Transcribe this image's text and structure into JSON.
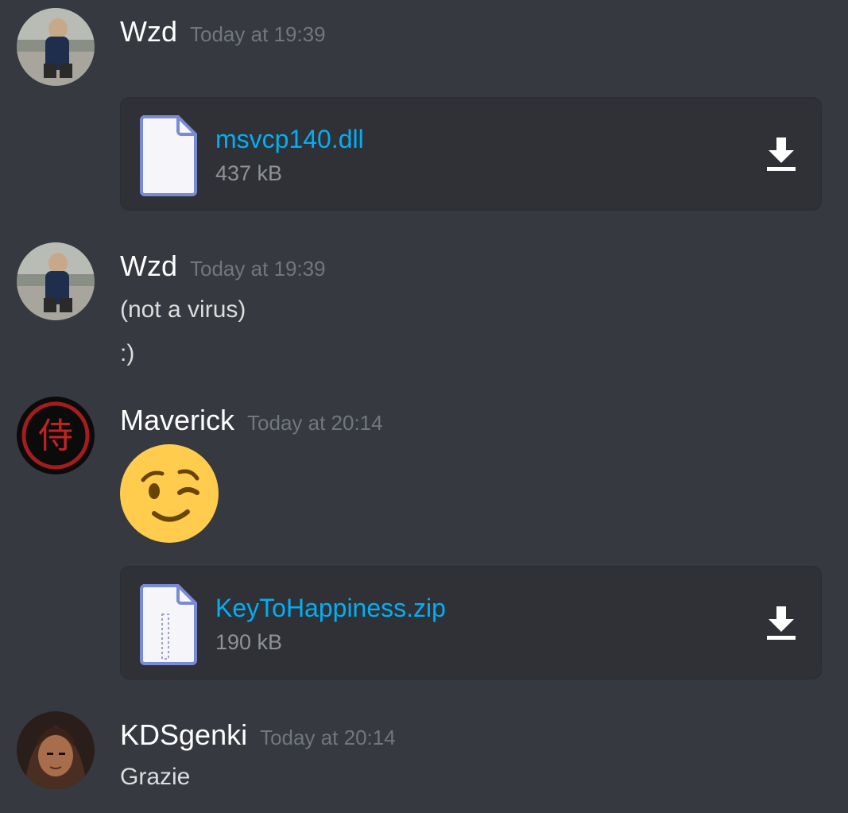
{
  "messages": [
    {
      "author": "Wzd",
      "timestamp": "Today at 19:39",
      "avatar": "photo-avatar",
      "attachment": {
        "file_name": "msvcp140.dll",
        "file_size": "437 kB",
        "icon": "document-file-icon"
      }
    },
    {
      "author": "Wzd",
      "timestamp": "Today at 19:39",
      "avatar": "photo-avatar",
      "lines": [
        "(not a virus)",
        ":)"
      ]
    },
    {
      "author": "Maverick",
      "timestamp": "Today at 20:14",
      "avatar": "red-kanji-avatar",
      "emoji": "winking-face",
      "attachment": {
        "file_name": "KeyToHappiness.zip",
        "file_size": "190 kB",
        "icon": "zip-file-icon"
      }
    },
    {
      "author": "KDSgenki",
      "timestamp": "Today at 20:14",
      "avatar": "anime-avatar",
      "lines": [
        "Grazie"
      ]
    }
  ],
  "colors": {
    "background": "#36393f",
    "attachment_bg": "#2f3136",
    "link": "#00aff4",
    "timestamp": "#72767d",
    "username": "#ffffff"
  }
}
